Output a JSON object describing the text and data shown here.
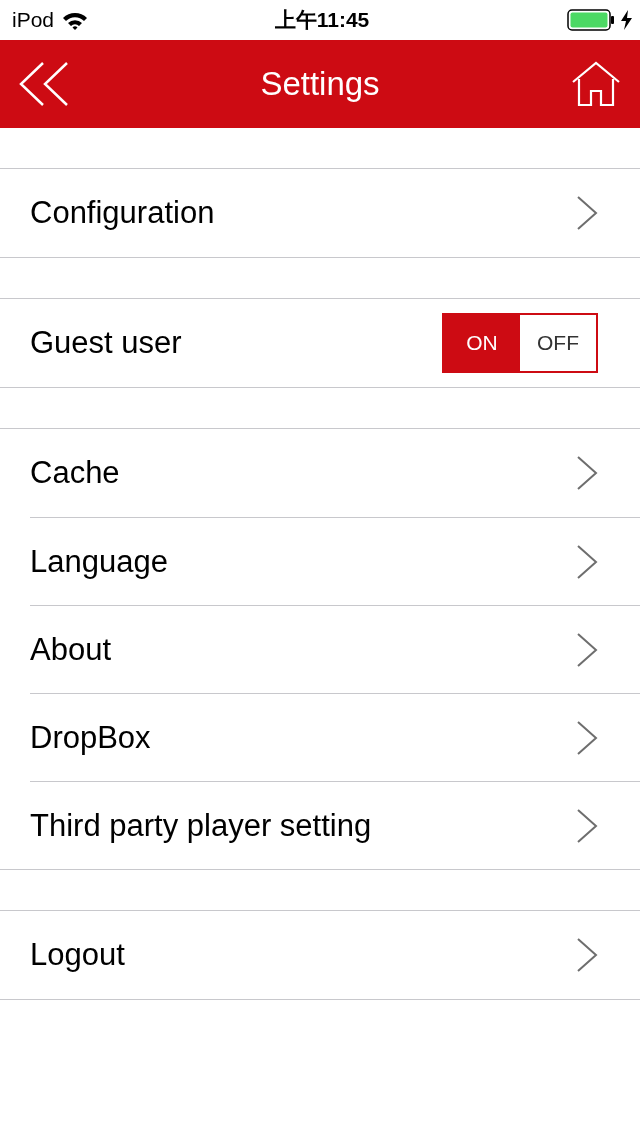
{
  "status_bar": {
    "carrier": "iPod",
    "time": "上午11:45",
    "battery": {
      "level": 1,
      "charging": true
    }
  },
  "nav_bar": {
    "title": "Settings"
  },
  "sections": [
    {
      "rows": [
        {
          "kind": "link",
          "label": "Configuration"
        }
      ]
    },
    {
      "rows": [
        {
          "kind": "toggle",
          "label": "Guest user",
          "options": [
            {
              "label": "ON",
              "selected": true
            },
            {
              "label": "OFF",
              "selected": false
            }
          ]
        }
      ]
    },
    {
      "rows": [
        {
          "kind": "link",
          "label": "Cache"
        },
        {
          "kind": "link",
          "label": "Language"
        },
        {
          "kind": "link",
          "label": "About"
        },
        {
          "kind": "link",
          "label": "DropBox"
        },
        {
          "kind": "link",
          "label": "Third party player setting"
        }
      ]
    },
    {
      "rows": [
        {
          "kind": "link",
          "label": "Logout"
        }
      ]
    }
  ]
}
